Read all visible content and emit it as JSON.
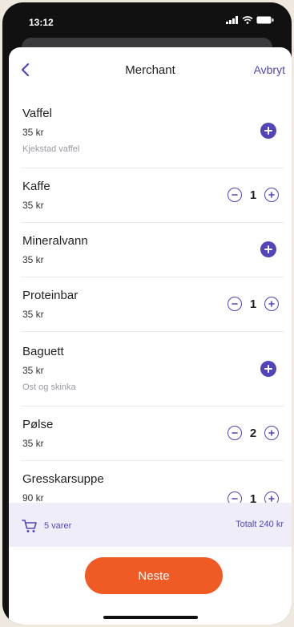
{
  "status_bar": {
    "time": "13:12"
  },
  "header": {
    "title": "Merchant",
    "cancel_label": "Avbryt"
  },
  "items": [
    {
      "name": "Vaffel",
      "price": "35 kr",
      "description": "Kjekstad vaffel",
      "quantity": null
    },
    {
      "name": "Kaffe",
      "price": "35 kr",
      "description": "",
      "quantity": "1"
    },
    {
      "name": "Mineralvann",
      "price": "35 kr",
      "description": "",
      "quantity": null
    },
    {
      "name": "Proteinbar",
      "price": "35 kr",
      "description": "",
      "quantity": "1"
    },
    {
      "name": "Baguett",
      "price": "35 kr",
      "description": "Ost og skinka",
      "quantity": null
    },
    {
      "name": "Pølse",
      "price": "35 kr",
      "description": "",
      "quantity": "2"
    },
    {
      "name": "Gresskarsuppe",
      "price": "90 kr",
      "description": "",
      "quantity": "1"
    }
  ],
  "cart": {
    "count_label": "5 varer",
    "total_label": "Totalt 240 kr"
  },
  "next_button": {
    "label": "Neste"
  },
  "colors": {
    "accent": "#5145b8",
    "primary_button": "#f05a24",
    "footer_bg": "#efeef8"
  }
}
